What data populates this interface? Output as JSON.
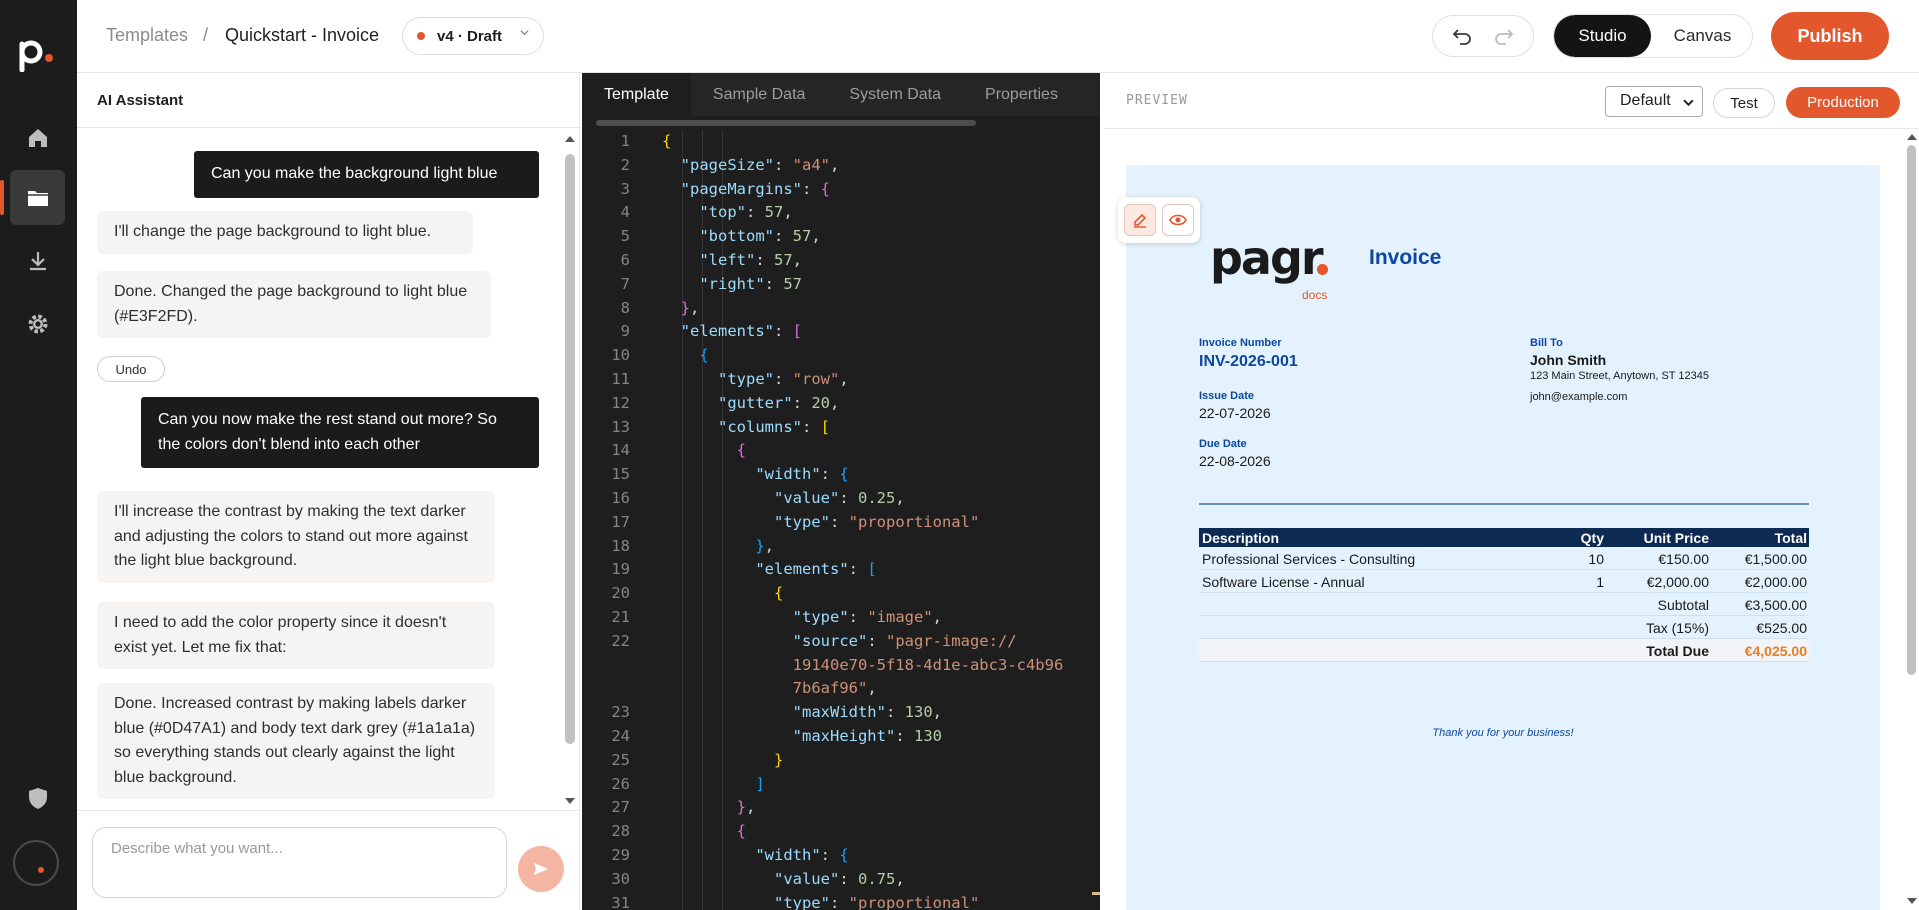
{
  "app": {
    "breadcrumb_root": "Templates",
    "breadcrumb_sep": "/",
    "breadcrumb_page": "Quickstart - Invoice",
    "version": "v4 · Draft",
    "view_studio": "Studio",
    "view_canvas": "Canvas",
    "publish": "Publish",
    "accent": "#e2572b"
  },
  "assistant": {
    "title": "AI Assistant",
    "messages": [
      {
        "role": "user",
        "text": "Can you make the background light blue"
      },
      {
        "role": "ai",
        "text": "I'll change the page background to light blue."
      },
      {
        "role": "ai",
        "text": "Done. Changed the page background to light blue (#E3F2FD)."
      },
      {
        "role": "user",
        "text": "Can you now make the rest stand out more? So the colors don't blend into each other"
      },
      {
        "role": "ai",
        "text": "I'll increase the contrast by making the text darker and adjusting the colors to stand out more against the light blue background."
      },
      {
        "role": "ai",
        "text": "I need to add the color property since it doesn't exist yet. Let me fix that:"
      },
      {
        "role": "ai",
        "text": "Done. Increased contrast by making labels darker blue (#0D47A1) and body text dark grey (#1a1a1a) so everything stands out clearly against the light blue background."
      }
    ],
    "undo": "Undo",
    "placeholder": "Describe what you want..."
  },
  "editor": {
    "tabs": [
      "Template",
      "Sample Data",
      "System Data",
      "Properties"
    ],
    "line_numbers": [
      "1",
      "2",
      "3",
      "4",
      "5",
      "6",
      "7",
      "8",
      "9",
      "10",
      "11",
      "12",
      "13",
      "14",
      "15",
      "16",
      "17",
      "18",
      "19",
      "20",
      "21",
      "22",
      "",
      "",
      "23",
      "24",
      "25",
      "26",
      "27",
      "28",
      "29",
      "30",
      "31"
    ],
    "code": {
      "pageSize_key": "\"pageSize\"",
      "pageSize_val": "\"a4\"",
      "pageMargins_key": "\"pageMargins\"",
      "top_key": "\"top\"",
      "top_val": "57",
      "bottom_key": "\"bottom\"",
      "bottom_val": "57",
      "left_key": "\"left\"",
      "left_val": "57",
      "right_key": "\"right\"",
      "right_val": "57",
      "elements_key": "\"elements\"",
      "type_key": "\"type\"",
      "row_val": "\"row\"",
      "gutter_key": "\"gutter\"",
      "gutter_val": "20",
      "columns_key": "\"columns\"",
      "width_key": "\"width\"",
      "value_key": "\"value\"",
      "value1": "0.25",
      "proportional": "\"proportional\"",
      "image_val": "\"image\"",
      "source_key": "\"source\"",
      "source_l1": "\"pagr-image://",
      "source_l2": "19140e70-5f18-4d1e-abc3-c4b96",
      "source_l3": "7b6af96\"",
      "maxWidth_key": "\"maxWidth\"",
      "maxWidth_val": "130",
      "maxHeight_key": "\"maxHeight\"",
      "maxHeight_val": "130",
      "value2": "0.75"
    }
  },
  "preview": {
    "label": "PREVIEW",
    "env_select": "Default",
    "test": "Test",
    "production": "Production",
    "paper_bg": "#e3f2fd",
    "invoice": {
      "logo_text": "pagr",
      "logo_sub": "docs",
      "title": "Invoice",
      "invoice_number_label": "Invoice Number",
      "invoice_number": "INV-2026-001",
      "issue_date_label": "Issue Date",
      "issue_date": "22-07-2026",
      "due_date_label": "Due Date",
      "due_date": "22-08-2026",
      "bill_to_label": "Bill To",
      "bill_to_name": "John Smith",
      "bill_to_address": "123 Main Street, Anytown, ST 12345",
      "bill_to_email": "john@example.com",
      "columns": [
        "Description",
        "Qty",
        "Unit Price",
        "Total"
      ],
      "items": [
        {
          "desc": "Professional Services - Consulting",
          "qty": "10",
          "unit": "€150.00",
          "total": "€1,500.00"
        },
        {
          "desc": "Software License - Annual",
          "qty": "1",
          "unit": "€2,000.00",
          "total": "€2,000.00"
        }
      ],
      "subtotal_label": "Subtotal",
      "subtotal": "€3,500.00",
      "tax_label": "Tax (15%)",
      "tax": "€525.00",
      "total_due_label": "Total Due",
      "total_due": "€4,025.00",
      "thanks": "Thank you for your business!"
    }
  }
}
